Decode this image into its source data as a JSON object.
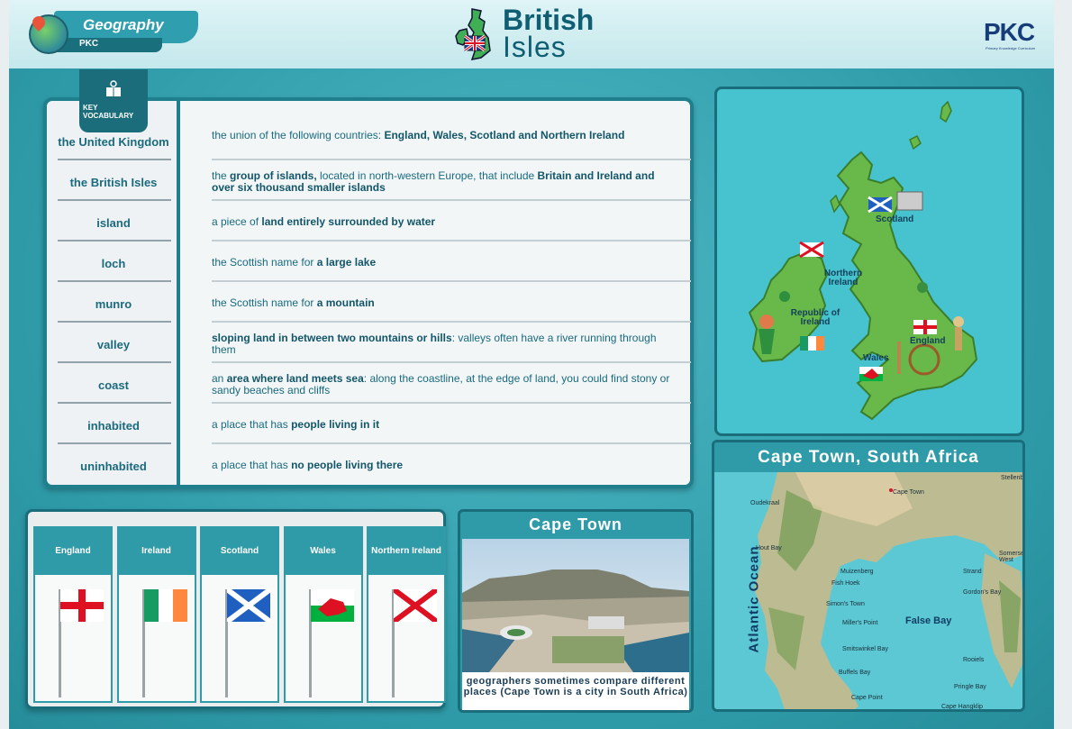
{
  "header": {
    "subject": "Geography",
    "org_short": "PKC",
    "title_line1": "British",
    "title_line2": "Isles",
    "logo": "PKC",
    "logo_tagline": "Primary Knowledge Curriculum"
  },
  "vocabulary": {
    "badge_line1": "KEY",
    "badge_line2": "VOCABULARY",
    "items": [
      {
        "term": "the United Kingdom",
        "def": [
          {
            "t": "the union of the following countries: ",
            "b": false
          },
          {
            "t": "England, Wales, Scotland and Northern Ireland",
            "b": true
          }
        ]
      },
      {
        "term": "the British Isles",
        "def": [
          {
            "t": "the ",
            "b": false
          },
          {
            "t": "group of islands,",
            "b": true
          },
          {
            "t": " located in north-western Europe, that include ",
            "b": false
          },
          {
            "t": "Britain and Ireland and over six thousand smaller islands",
            "b": true
          }
        ]
      },
      {
        "term": "island",
        "def": [
          {
            "t": "a piece of ",
            "b": false
          },
          {
            "t": "land entirely surrounded by water",
            "b": true
          }
        ]
      },
      {
        "term": "loch",
        "def": [
          {
            "t": "the Scottish name for ",
            "b": false
          },
          {
            "t": "a large lake",
            "b": true
          }
        ]
      },
      {
        "term": "munro",
        "def": [
          {
            "t": "the Scottish name for ",
            "b": false
          },
          {
            "t": "a mountain",
            "b": true
          }
        ]
      },
      {
        "term": "valley",
        "def": [
          {
            "t": "sloping land in between two mountains or hills",
            "b": true
          },
          {
            "t": ": valleys often have a river running through them",
            "b": false
          }
        ]
      },
      {
        "term": "coast",
        "def": [
          {
            "t": "an ",
            "b": false
          },
          {
            "t": "area where land meets sea",
            "b": true
          },
          {
            "t": ": along the coastline, at the edge of land, you could find stony or sandy beaches and cliffs",
            "b": false
          }
        ]
      },
      {
        "term": "inhabited",
        "def": [
          {
            "t": "a place that has ",
            "b": false
          },
          {
            "t": "people living in it",
            "b": true
          }
        ]
      },
      {
        "term": "uninhabited",
        "def": [
          {
            "t": "a place that has ",
            "b": false
          },
          {
            "t": "no people living there",
            "b": true
          }
        ]
      }
    ]
  },
  "map": {
    "labels": {
      "scotland": "Scotland",
      "northern_ireland": "Northern Ireland",
      "republic_of_ireland": "Republic of Ireland",
      "england": "England",
      "wales": "Wales"
    }
  },
  "flags": [
    {
      "name": "England",
      "icon": "england-flag-icon"
    },
    {
      "name": "Ireland",
      "icon": "ireland-flag-icon"
    },
    {
      "name": "Scotland",
      "icon": "scotland-flag-icon"
    },
    {
      "name": "Wales",
      "icon": "wales-flag-icon"
    },
    {
      "name": "Northern Ireland",
      "icon": "northern-ireland-flag-icon"
    }
  ],
  "cape_town_photo": {
    "title": "Cape Town",
    "caption": "geographers sometimes compare different places (Cape Town is a city in South Africa)"
  },
  "cape_town_map": {
    "title": "Cape Town, South Africa",
    "ocean": "Atlantic Ocean",
    "bay": "False Bay",
    "places": [
      "Oudekraal",
      "Hout Bay",
      "Muizenberg",
      "Fish Hoek",
      "Simon's Town",
      "Miller's Point",
      "Smitswinkel Bay",
      "Buffels Bay",
      "Cape Point",
      "Strand",
      "Gordon's Bay",
      "Rooiels",
      "Pringle Bay",
      "Cape Hangklip",
      "Stellenbosch",
      "Somerset West",
      "Cape Town"
    ]
  },
  "colors": {
    "teal_dark": "#1a6e7b",
    "teal_mid": "#2f9aa8",
    "text_teal": "#186a7f"
  }
}
